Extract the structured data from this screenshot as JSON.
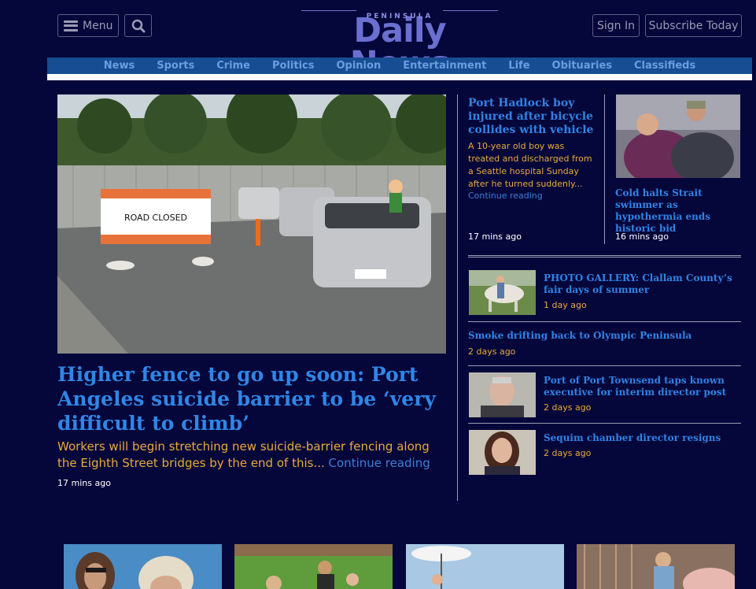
{
  "header": {
    "menu_label": "Menu",
    "logo_top": "PENINSULA",
    "logo_main": "Daily News",
    "signin_label": "Sign In",
    "subscribe_label": "Subscribe Today"
  },
  "nav": [
    "News",
    "Sports",
    "Crime",
    "Politics",
    "Opinion",
    "Entertainment",
    "Life",
    "Obituaries",
    "Classifieds"
  ],
  "lead": {
    "sign_text": "ROAD CLOSED",
    "title": "Higher fence to go up soon: Port Angeles suicide barrier to be ‘very difficult to climb’",
    "summary": "Workers will begin stretching new suicide-barrier fencing along the Eighth Street bridges by the end of this...",
    "continue": "Continue reading",
    "time": "17 mins ago"
  },
  "top_story": {
    "title": "Port Hadlock boy injured after bicycle collides with vehicle",
    "summary": "A 10-year old boy was treated and discharged from a Seattle hospital Sunday after he turned suddenly...",
    "continue": "Continue reading",
    "time": "17 mins ago"
  },
  "side_story": {
    "title": "Cold halts Strait swimmer as hypothermia ends historic bid",
    "time": "16 mins ago"
  },
  "list": [
    {
      "title": "PHOTO GALLERY: Clallam County’s fair days of summer",
      "time": "1 day ago"
    },
    {
      "title": "Smoke drifting back to Olympic Peninsula",
      "time": "2 days ago"
    },
    {
      "title": "Port of Port Townsend taps known executive for interim director post",
      "time": "2 days ago"
    },
    {
      "title": "Sequim chamber director resigns",
      "time": "2 days ago"
    }
  ],
  "colors": {
    "background": "#05063a",
    "headline_blue": "#3183e4",
    "summary_orange": "#e8aa3c",
    "nav_bar": "#174d92"
  }
}
